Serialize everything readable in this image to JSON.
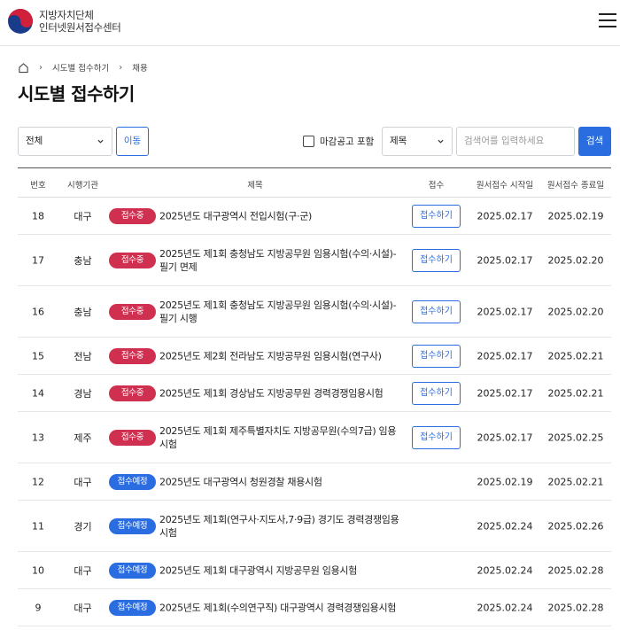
{
  "header": {
    "logo_line1": "지방자치단체",
    "logo_line2": "인터넷원서접수센터"
  },
  "breadcrumb": {
    "items": [
      "시도별 접수하기",
      "채용"
    ]
  },
  "page_title": "시도별 접수하기",
  "filters": {
    "region_value": "전체",
    "move_label": "이동",
    "deadline_label": "마감공고 포함",
    "field_value": "제목",
    "search_placeholder": "검색어를 입력하세요",
    "search_label": "검색"
  },
  "table": {
    "headers": [
      "번호",
      "시행기관",
      "제목",
      "접수",
      "원서접수 시작일",
      "원서접수 종료일"
    ],
    "rows": [
      {
        "no": "18",
        "org": "대구",
        "status": "접수중",
        "title": "2025년도 대구광역시 전입시험(구·군)",
        "apply": "접수하기",
        "start": "2025.02.17",
        "end": "2025.02.19"
      },
      {
        "no": "17",
        "org": "충남",
        "status": "접수중",
        "title": "2025년도 제1회 충청남도 지방공무원 임용시험(수의·시설)-필기 면제",
        "apply": "접수하기",
        "start": "2025.02.17",
        "end": "2025.02.20"
      },
      {
        "no": "16",
        "org": "충남",
        "status": "접수중",
        "title": "2025년도 제1회 충청남도 지방공무원 임용시험(수의·시설)-필기 시행",
        "apply": "접수하기",
        "start": "2025.02.17",
        "end": "2025.02.20"
      },
      {
        "no": "15",
        "org": "전남",
        "status": "접수중",
        "title": "2025년도 제2회 전라남도 지방공무원 임용시험(연구사)",
        "apply": "접수하기",
        "start": "2025.02.17",
        "end": "2025.02.21"
      },
      {
        "no": "14",
        "org": "경남",
        "status": "접수중",
        "title": "2025년도 제1회 경상남도 지방공무원 경력경쟁임용시험",
        "apply": "접수하기",
        "start": "2025.02.17",
        "end": "2025.02.21"
      },
      {
        "no": "13",
        "org": "제주",
        "status": "접수중",
        "title": "2025년도 제1회 제주특별자치도 지방공무원(수의7급) 임용시험",
        "apply": "접수하기",
        "start": "2025.02.17",
        "end": "2025.02.25"
      },
      {
        "no": "12",
        "org": "대구",
        "status": "접수예정",
        "title": "2025년도 대구광역시 청원경찰 채용시험",
        "apply": "",
        "start": "2025.02.19",
        "end": "2025.02.21"
      },
      {
        "no": "11",
        "org": "경기",
        "status": "접수예정",
        "title": "2025년도 제1회(연구사·지도사,7·9급) 경기도 경력경쟁임용시험",
        "apply": "",
        "start": "2025.02.24",
        "end": "2025.02.26"
      },
      {
        "no": "10",
        "org": "대구",
        "status": "접수예정",
        "title": "2025년도 제1회 대구광역시 지방공무원 임용시험",
        "apply": "",
        "start": "2025.02.24",
        "end": "2025.02.28"
      },
      {
        "no": "9",
        "org": "대구",
        "status": "접수예정",
        "title": "2025년도 제1회(수의연구직) 대구광역시 경력경쟁임용시험",
        "apply": "",
        "start": "2025.02.24",
        "end": "2025.02.28"
      }
    ]
  },
  "colors": {
    "accent": "#2a6de0",
    "status_open": "#d03050",
    "status_upcoming": "#2a6de0"
  }
}
